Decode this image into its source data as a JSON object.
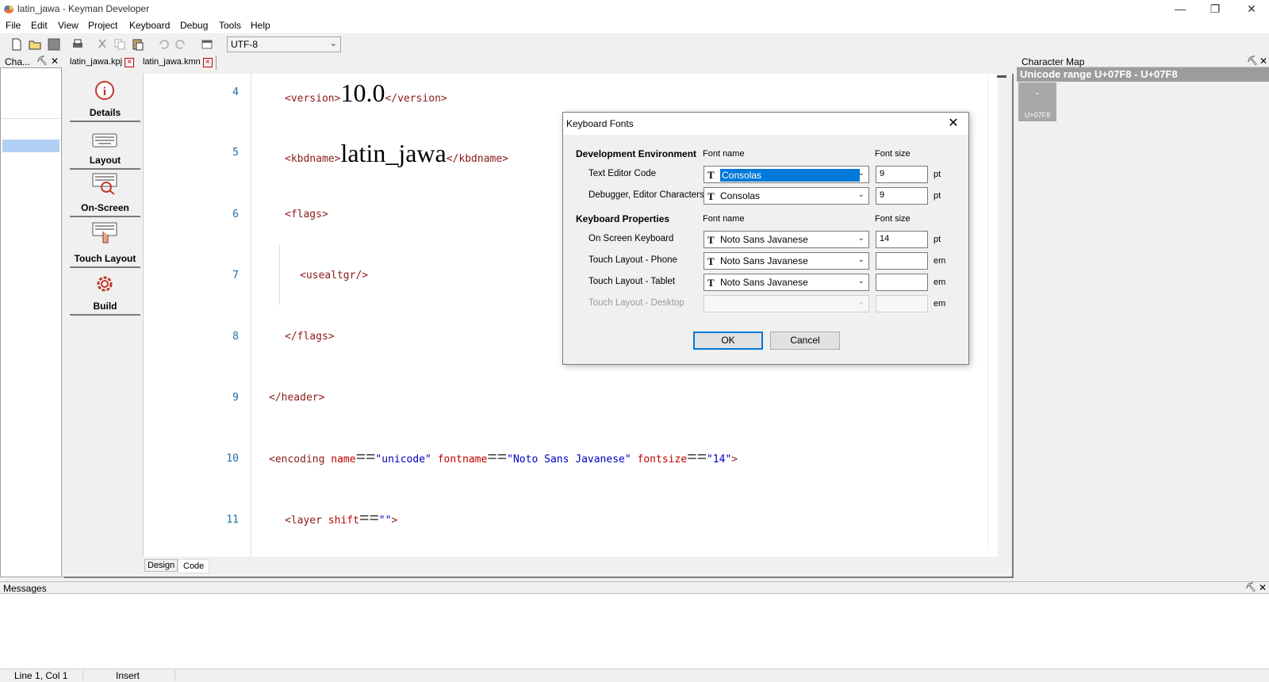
{
  "window": {
    "title": "latin_jawa - Keyman Developer",
    "controls": [
      "minimize",
      "restore",
      "close"
    ]
  },
  "menu": [
    "File",
    "Edit",
    "View",
    "Project",
    "Keyboard",
    "Debug",
    "Tools",
    "Help"
  ],
  "toolbar": {
    "encoding": "UTF-8",
    "icons": [
      "new-file-icon",
      "open-folder-icon",
      "save-icon",
      "print-icon",
      "cut-icon",
      "copy-icon",
      "paste-icon",
      "undo-icon",
      "redo-icon",
      "window-icon"
    ]
  },
  "left_panel": {
    "title": "Cha..."
  },
  "tabs": [
    {
      "label": "latin_jawa.kpj"
    },
    {
      "label": "latin_jawa.kmn"
    }
  ],
  "sidenav": [
    {
      "label": "Details",
      "icon": "info-icon"
    },
    {
      "label": "Layout",
      "icon": "keyboard-icon"
    },
    {
      "label": "On-Screen",
      "icon": "on-screen-keyboard-icon"
    },
    {
      "label": "Touch Layout",
      "icon": "touch-layout-icon"
    },
    {
      "label": "Build",
      "icon": "gear-icon"
    }
  ],
  "editor": {
    "lines": [
      {
        "num": "4",
        "open": "<version>",
        "big": "10.0",
        "close": "</version>"
      },
      {
        "num": "5",
        "open": "<kbdname>",
        "big": "latin_jawa",
        "close": "</kbdname>"
      },
      {
        "num": "6",
        "text": "<flags>"
      },
      {
        "num": "7",
        "text": "<usealtgr/>"
      },
      {
        "num": "8",
        "text": "</flags>"
      },
      {
        "num": "9",
        "text": "</header>"
      },
      {
        "num": "10",
        "tag": "<encoding",
        "a1": "name",
        "v1": "\"unicode\"",
        "a2": "fontname",
        "v2": "\"Noto Sans Javanese\"",
        "a3": "fontsize",
        "v3": "\"14\"",
        "end": ">"
      },
      {
        "num": "11",
        "tag": "<layer",
        "a1": "shift",
        "v1": "\"\"",
        "end": ">"
      }
    ],
    "eq": "=="
  },
  "bottom_tabs": [
    "Design",
    "Code"
  ],
  "charmap": {
    "title": "Character Map",
    "range": "Unicode range U+07F8 - U+07F8",
    "cell_glyph": "·",
    "cell_code": "U+07F8"
  },
  "messages": {
    "title": "Messages"
  },
  "status": {
    "position": "Line 1, Col 1",
    "mode": "Insert"
  },
  "dialog": {
    "title": "Keyboard Fonts",
    "dev_section": "Development Environment",
    "kbd_section": "Keyboard Properties",
    "col_font_name": "Font name",
    "col_font_size": "Font size",
    "rows": [
      {
        "label": "Text Editor Code",
        "font": "Consolas",
        "size": "9",
        "unit": "pt"
      },
      {
        "label": "Debugger, Editor Characters",
        "font": "Consolas",
        "size": "9",
        "unit": "pt"
      },
      {
        "label": "On Screen Keyboard",
        "font": "Noto Sans Javanese",
        "size": "14",
        "unit": "pt"
      },
      {
        "label": "Touch Layout - Phone",
        "font": "Noto Sans Javanese",
        "size": "",
        "unit": "em"
      },
      {
        "label": "Touch Layout - Tablet",
        "font": "Noto Sans Javanese",
        "size": "",
        "unit": "em"
      },
      {
        "label": "Touch Layout - Desktop",
        "font": "",
        "size": "",
        "unit": "em"
      }
    ],
    "ok": "OK",
    "cancel": "Cancel"
  }
}
